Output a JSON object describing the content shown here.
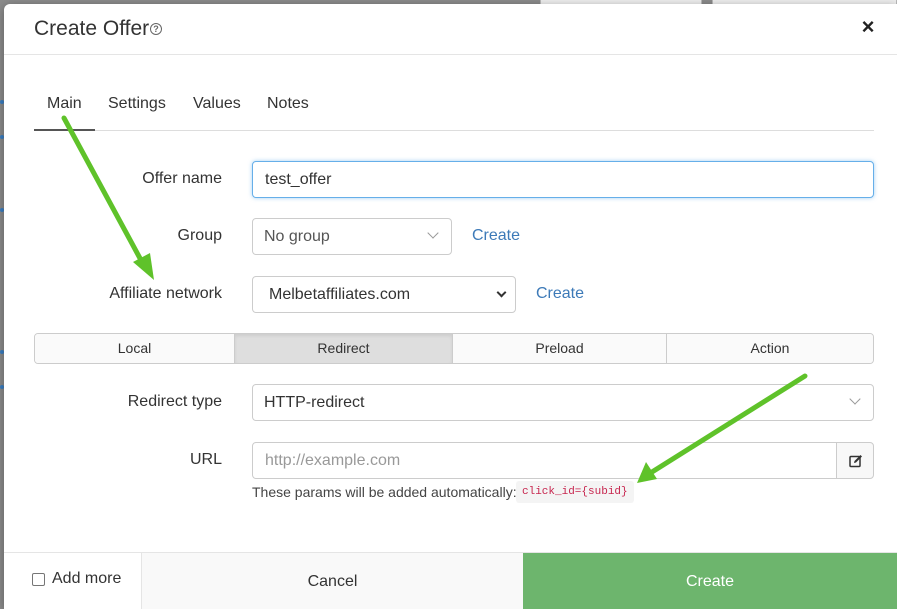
{
  "dialog": {
    "title": "Create Offer",
    "help_icon": "question-circle-icon",
    "close_icon": "close-icon"
  },
  "tabs": [
    {
      "label": "Main",
      "active": true
    },
    {
      "label": "Settings",
      "active": false
    },
    {
      "label": "Values",
      "active": false
    },
    {
      "label": "Notes",
      "active": false
    }
  ],
  "form": {
    "offer_name": {
      "label": "Offer name",
      "value": "test_offer"
    },
    "group": {
      "label": "Group",
      "value": "No group",
      "create_link": "Create"
    },
    "affiliate_network": {
      "label": "Affiliate network",
      "value": "Melbetaffiliates.com",
      "create_link": "Create"
    },
    "mode_tabs": [
      {
        "label": "Local",
        "active": false
      },
      {
        "label": "Redirect",
        "active": true
      },
      {
        "label": "Preload",
        "active": false
      },
      {
        "label": "Action",
        "active": false
      }
    ],
    "redirect_type": {
      "label": "Redirect type",
      "value": "HTTP-redirect"
    },
    "url": {
      "label": "URL",
      "placeholder": "http://example.com",
      "edit_icon": "pencil-square-icon",
      "hint": "These params will be added automatically:",
      "code": "click_id={subid}"
    }
  },
  "footer": {
    "add_more_label": "Add more",
    "add_more_checked": false,
    "cancel_label": "Cancel",
    "create_label": "Create"
  },
  "colors": {
    "create_button": "#6db56d",
    "link": "#3d7ab8",
    "annotation_arrow": "#5fc22a"
  }
}
